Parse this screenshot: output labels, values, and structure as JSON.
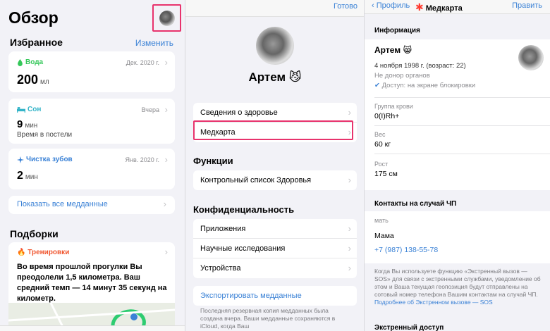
{
  "summary": {
    "title": "Обзор",
    "favorites_title": "Избранное",
    "edit_label": "Изменить",
    "cards": [
      {
        "category": "Вода",
        "date": "Дек. 2020 г.",
        "value": "200",
        "unit": "мл",
        "subtitle": "",
        "color": "#34c759"
      },
      {
        "category": "Сон",
        "date": "Вчера",
        "value": "9",
        "unit": "мин",
        "subtitle": "Время в постели",
        "color": "#34b4c8"
      },
      {
        "category": "Чистка зубов",
        "date": "Янв. 2020 г.",
        "value": "2",
        "unit": "мин",
        "subtitle": "",
        "color": "#3b82d6"
      }
    ],
    "show_all_label": "Показать все медданные",
    "highlights_title": "Подборки",
    "highlight": {
      "category": "Тренировки",
      "text": "Во время прошлой прогулки Вы преодолели 1,5 километра. Ваш средний темп — 14 минут 35 секунд на километр."
    }
  },
  "profile": {
    "done_label": "Готово",
    "name": "Артем 😼",
    "rows_top": [
      "Сведения о здоровье",
      "Медкарта"
    ],
    "functions_title": "Функции",
    "functions_rows": [
      "Контрольный список Здоровья"
    ],
    "privacy_title": "Конфиденциальность",
    "privacy_rows": [
      "Приложения",
      "Научные исследования",
      "Устройства"
    ],
    "export_label": "Экспортировать медданные",
    "footnote": "Последняя резервная копия медданных была создана вчера. Ваши медданные сохраняются в iCloud, когда Ваш"
  },
  "medical_id": {
    "back_label": "Профиль",
    "title": "Медкарта",
    "edit_label": "Править",
    "info_title": "Информация",
    "name": "Артем 😸",
    "birth": "4 ноября 1998 г. (возраст: 22)",
    "donor": "Не донор органов",
    "lock_access": "Доступ: на экране блокировки",
    "fields": [
      {
        "label": "Группа крови",
        "value": "0(I)Rh+"
      },
      {
        "label": "Вес",
        "value": "60 кг"
      },
      {
        "label": "Рост",
        "value": "175 см"
      }
    ],
    "emergency_title": "Контакты на случай ЧП",
    "contact_relation": "мать",
    "contact_name": "Мама",
    "contact_phone": "+7 (987) 138-55-78",
    "note": "Когда Вы используете функцию «Экстренный вызов — SOS» для связи с экстренными службами, уведомление об этом и Ваша текущая геопозиция будут отправлены на сотовый номер телефона Вашим контактам на случай ЧП. ",
    "note_link": "Подробнее об Экстренном вызове — SOS",
    "emergency_access_title": "Экстренный доступ"
  },
  "colors": {
    "accent": "#3b82d6",
    "highlight_border": "#e8336d",
    "workout": "#f0562f",
    "star": "#ff3b30"
  }
}
